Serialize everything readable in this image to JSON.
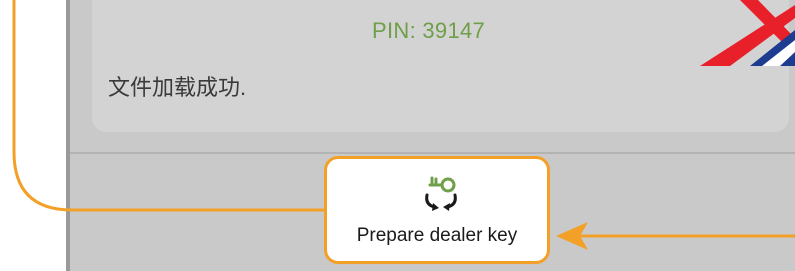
{
  "dialog": {
    "pin_text": "PIN: 39147",
    "message": "文件加载成功."
  },
  "actions": {
    "prepare_dealer_key_label": "Prepare dealer key",
    "prepare_dealer_key_icon": "key-refresh-icon"
  },
  "colors": {
    "accent_orange": "#f3a028",
    "pin_green": "#6f9f48",
    "panel_gray": "#c9c9c9",
    "logo_red": "#e8202a",
    "logo_blue": "#1d3b8f"
  }
}
